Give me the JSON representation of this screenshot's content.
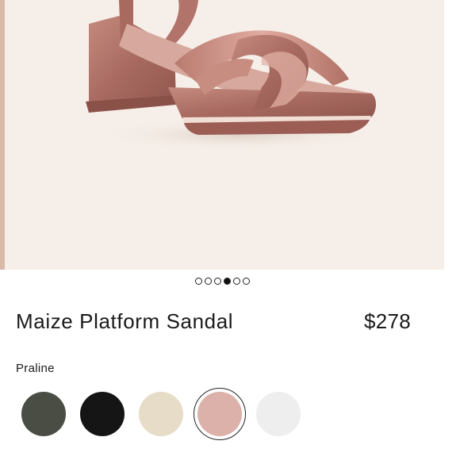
{
  "product": {
    "name": "Maize Platform Sandal",
    "price": "$278",
    "selected_color": "Praline"
  },
  "carousel": {
    "dot_count": 6,
    "active_index": 3
  },
  "swatches": [
    {
      "name": "olive-swatch",
      "color": "#4a4d43",
      "selected": false
    },
    {
      "name": "black-swatch",
      "color": "#151515",
      "selected": false
    },
    {
      "name": "cream-swatch",
      "color": "#e6dcc8",
      "selected": false
    },
    {
      "name": "praline-swatch",
      "color": "#dbb1aa",
      "selected": true
    },
    {
      "name": "white-swatch",
      "color": "#eeeeef",
      "selected": false
    }
  ],
  "colors": {
    "hero_background": "#f6efe9",
    "sandal": "#b77a6f"
  }
}
